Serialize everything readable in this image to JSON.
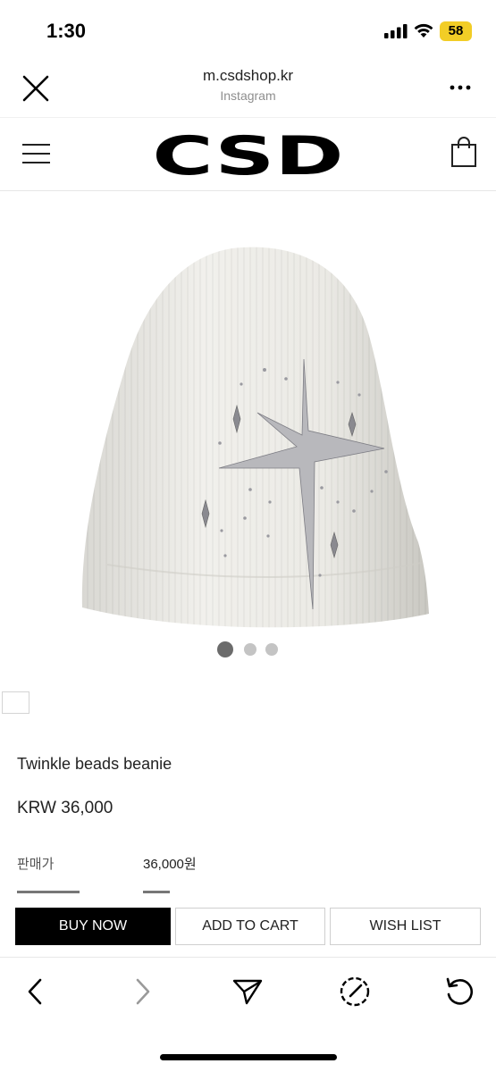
{
  "status_bar": {
    "time": "1:30",
    "battery": "58"
  },
  "browser": {
    "url": "m.csdshop.kr",
    "source": "Instagram"
  },
  "site": {
    "logo": "CSD"
  },
  "product": {
    "name": "Twinkle beads beanie",
    "price": "KRW 36,000",
    "sale_price_label": "판매가",
    "sale_price_value": "36,000원",
    "image_count": 3,
    "active_image": 1
  },
  "actions": {
    "buy_now": "BUY NOW",
    "add_to_cart": "ADD TO CART",
    "wish_list": "WISH LIST"
  },
  "icons": {
    "close": "close-icon",
    "more": "more-icon",
    "menu": "menu-icon",
    "bag": "shopping-bag-icon",
    "back": "chevron-left-icon",
    "forward": "chevron-right-icon",
    "share": "send-icon",
    "compass": "compass-icon",
    "reload": "reload-icon"
  },
  "colors": {
    "battery": "#f2cd26",
    "primary_button": "#000000",
    "dot_active": "#6b6b6b",
    "dot_inactive": "#c4c4c4"
  }
}
